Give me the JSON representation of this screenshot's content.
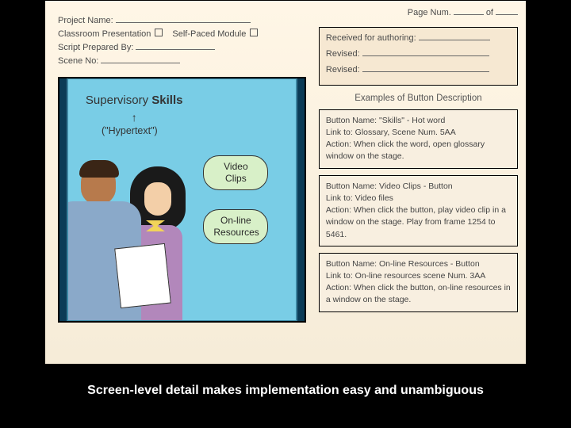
{
  "header": {
    "page_num_label": "Page Num.",
    "of": "of",
    "project_name_label": "Project Name:",
    "classroom_presentation_label": "Classroom Presentation",
    "self_paced_label": "Self-Paced Module",
    "script_prepared_label": "Script Prepared By:",
    "scene_no_label": "Scene No:"
  },
  "auth_box": {
    "received": "Received for authoring:",
    "revised1": "Revised:",
    "revised2": "Revised:"
  },
  "examples_header": "Examples of Button Description",
  "buttons": [
    {
      "name_label": "Button Name:",
      "name_value": "\"Skills\" - Hot word",
      "link_label": "Link to:",
      "link_value": "Glossary, Scene Num. 5AA",
      "action_label": "Action:",
      "action_value": "When click the word, open glossary window on the stage."
    },
    {
      "name_label": "Button Name:",
      "name_value": "Video Clips - Button",
      "link_label": "Link to:",
      "link_value": "Video files",
      "action_label": "Action:",
      "action_value": "When click the button, play video clip in a window on the stage. Play from frame 1254 to 5461."
    },
    {
      "name_label": "Button Name:",
      "name_value": "On-line Resources - Button",
      "link_label": "Link to:",
      "link_value": "On-line resources scene Num. 3AA",
      "action_label": "Action:",
      "action_value": "When click the button, on-line resources in a window on the stage."
    }
  ],
  "stage": {
    "title_part1": "Supervisory",
    "title_part2": "Skills",
    "hypertext": "(\"Hypertext\")",
    "arrow": "↑",
    "video_clips": "Video Clips",
    "online_resources": "On-line Resources"
  },
  "caption": "Screen-level detail makes implementation easy and unambiguous"
}
